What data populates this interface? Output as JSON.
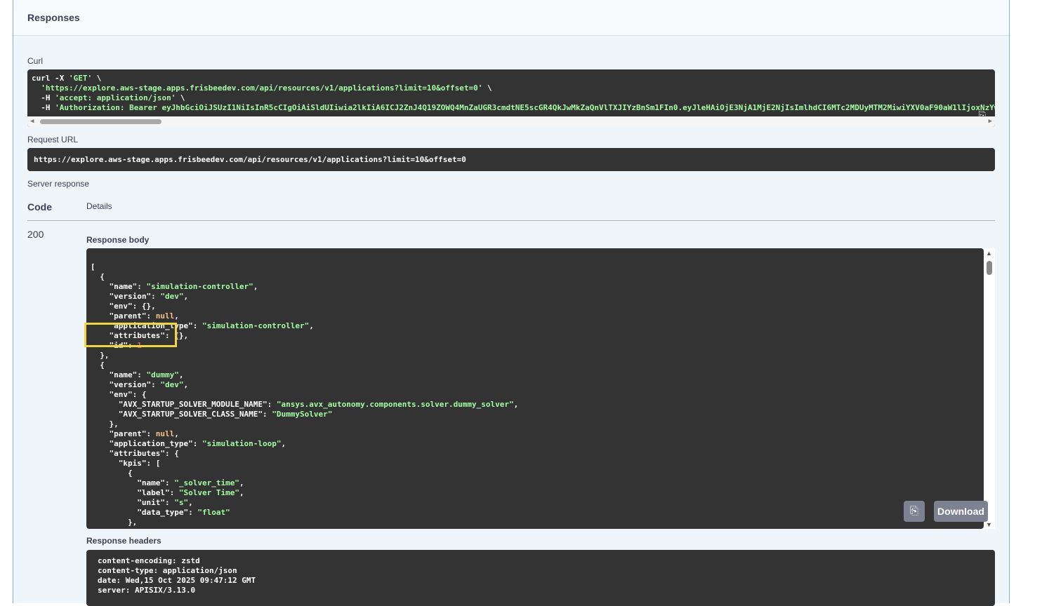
{
  "section": {
    "title": "Responses"
  },
  "curl": {
    "label": "Curl",
    "lines": [
      "curl -X 'GET' \\",
      "  'https://explore.aws-stage.apps.frisbeedev.com/api/resources/v1/applications?limit=10&offset=0' \\",
      "  -H 'accept: application/json' \\",
      "  -H 'Authorization: Bearer eyJhbGciOiJSUzI1NiIsInR5cCIgOiAiSldUIiwia2lkIiA6ICJ2ZnJ4Q19ZOWQ4MnZaUGR3cmdtNE5scGR4QkJwMkZaQnVlTXJIYzBnSm1FIn0.eyJleHAiOjE3NjA1MjE2NjIsImlhdCI6MTc2MDUyMTM2MiwiYXV0aF90aW1lIjoxNzYw"
    ]
  },
  "request_url": {
    "label": "Request URL",
    "value": "https://explore.aws-stage.apps.frisbeedev.com/api/resources/v1/applications?limit=10&offset=0"
  },
  "server_response": {
    "label": "Server response",
    "col_code": "Code",
    "col_details": "Details",
    "code": "200",
    "response_body_label": "Response body",
    "response_headers_label": "Response headers"
  },
  "response_body_lines": [
    "[",
    "  {",
    "    \"name\": \"simulation-controller\",",
    "    \"version\": \"dev\",",
    "    \"env\": {},",
    "    \"parent\": null,",
    "    \"application_type\": \"simulation-controller\",",
    "    \"attributes\": {},",
    "    \"id\": 1",
    "  },",
    "  {",
    "    \"name\": \"dummy\",",
    "    \"version\": \"dev\",",
    "    \"env\": {",
    "      \"AVX_STARTUP_SOLVER_MODULE_NAME\": \"ansys.avx_autonomy.components.solver.dummy_solver\",",
    "      \"AVX_STARTUP_SOLVER_CLASS_NAME\": \"DummySolver\"",
    "    },",
    "    \"parent\": null,",
    "    \"application_type\": \"simulation-loop\",",
    "    \"attributes\": {",
    "      \"kpis\": [",
    "        {",
    "          \"name\": \"_solver_time\",",
    "          \"label\": \"Solver Time\",",
    "          \"unit\": \"s\",",
    "          \"data_type\": \"float\"",
    "        },",
    "        {"
  ],
  "buttons": {
    "download": "Download"
  },
  "response_headers_lines": [
    "content-encoding: zstd",
    "content-type: application/json",
    "date: Wed,15 Oct 2025 09:47:12 GMT",
    "server: APISIX/3.13.0"
  ],
  "colors": {
    "panel_bg": "#eef6fb",
    "code_bg": "#333333",
    "string": "#a2fca2",
    "null": "#fcc28c",
    "number": "#d36363",
    "highlight": "#f3d63b",
    "button": "#7d8293"
  },
  "icons": [
    "copy-icon",
    "scroll-left-icon",
    "scroll-right-icon",
    "scroll-up-icon",
    "scroll-down-icon"
  ]
}
